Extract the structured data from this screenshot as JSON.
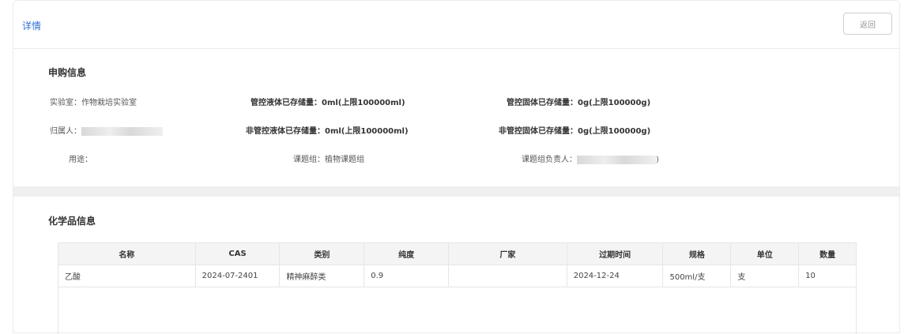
{
  "header": {
    "title": "详情",
    "back_label": "返回"
  },
  "purchase": {
    "section_title": "申购信息",
    "lab_label": "实验室：",
    "lab_value": "作物栽培实验室",
    "liquid_ctrl_label": "管控液体已存储量：",
    "liquid_ctrl_value": "0ml(上限100000ml)",
    "solid_ctrl_label": "管控固体已存储量：",
    "solid_ctrl_value": "0g(上限100000g)",
    "owner_label": "归属人：",
    "liquid_nonctrl_label": "非管控液体已存储量：",
    "liquid_nonctrl_value": "0ml(上限100000ml)",
    "solid_nonctrl_label": "非管控固体已存储量：",
    "solid_nonctrl_value": "0g(上限100000g)",
    "usage_label": "用途：",
    "group_label": "课题组：",
    "group_value": "植物课题组",
    "leader_label": "课题组负责人：",
    "leader_suffix": ")"
  },
  "chemicals": {
    "section_title": "化学品信息",
    "columns": [
      "名称",
      "CAS",
      "类别",
      "纯度",
      "厂家",
      "过期时间",
      "规格",
      "单位",
      "数量"
    ],
    "rows": [
      [
        "乙酸",
        "2024-07-2401",
        "精神麻醉类",
        "0.9",
        "",
        "2024-12-24",
        "500ml/支",
        "支",
        "10"
      ]
    ]
  }
}
